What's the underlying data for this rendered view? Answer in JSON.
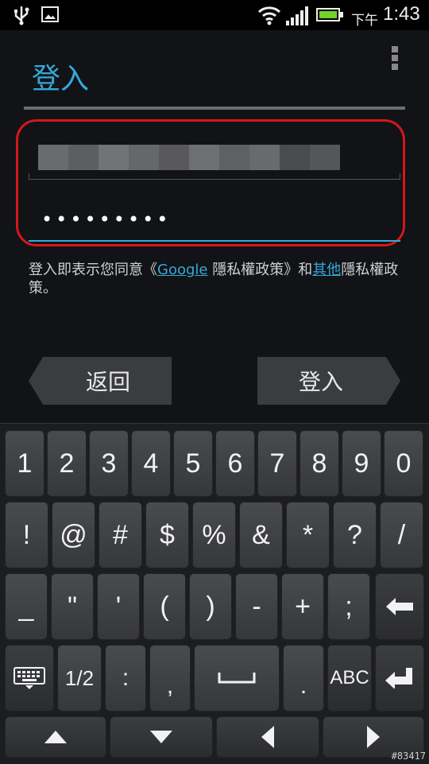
{
  "status_bar": {
    "ampm": "下午",
    "time": "1:43"
  },
  "header": {
    "title": "登入"
  },
  "form": {
    "password_mask": "•••••••••"
  },
  "terms": {
    "prefix": "登入即表示您同意《",
    "google_link": "Google",
    "middle": " 隱私權政策》和",
    "other_link": "其他",
    "suffix": "隱私權政策。"
  },
  "buttons": {
    "back": "返回",
    "signin": "登入"
  },
  "keyboard": {
    "row1": [
      "1",
      "2",
      "3",
      "4",
      "5",
      "6",
      "7",
      "8",
      "9",
      "0"
    ],
    "row2": [
      "!",
      "@",
      "#",
      "$",
      "%",
      "&",
      "*",
      "?",
      "/"
    ],
    "row3": [
      "_",
      "\"",
      "'",
      "(",
      ")",
      "-",
      "+",
      ";"
    ],
    "row4": {
      "half": "1/2",
      "colon": ":",
      "comma": ",",
      "period": ".",
      "abc": "ABC"
    }
  },
  "watermark": "#83417"
}
